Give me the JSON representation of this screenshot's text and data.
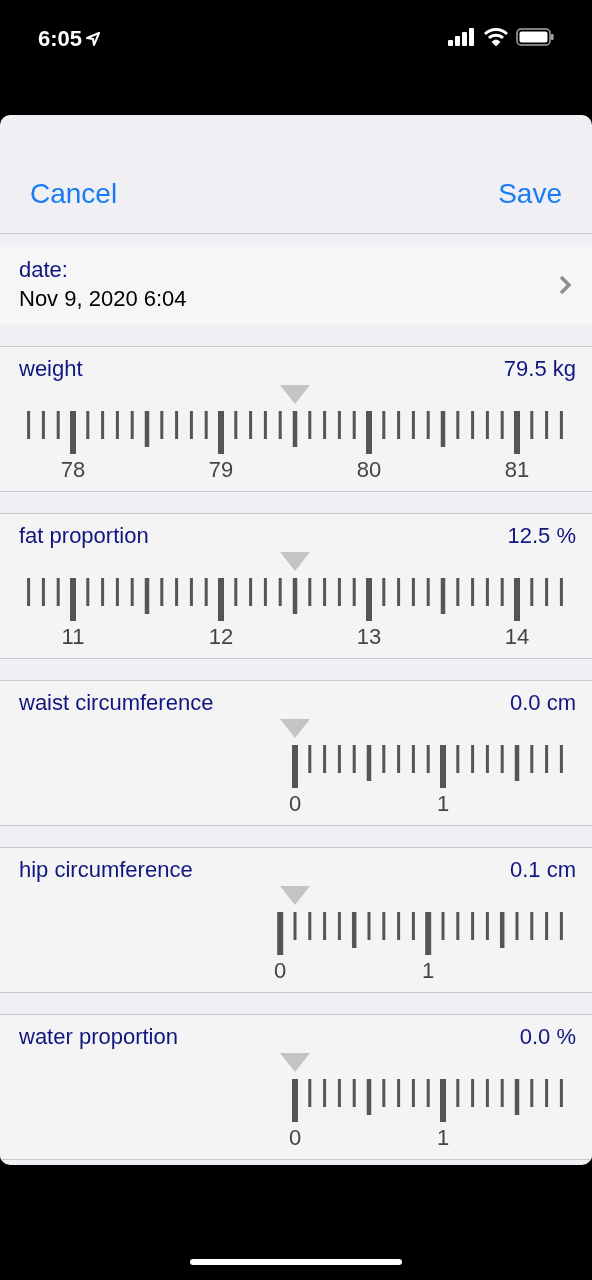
{
  "status_bar": {
    "time": "6:05"
  },
  "nav": {
    "cancel": "Cancel",
    "save": "Save"
  },
  "date_row": {
    "label": "date:",
    "value": "Nov 9, 2020 6:04"
  },
  "measurements": [
    {
      "name": "weight",
      "reading": "79.5 kg",
      "tick_labels": [
        "78",
        "79",
        "80",
        "81"
      ]
    },
    {
      "name": "fat proportion",
      "reading": "12.5 %",
      "tick_labels": [
        "11",
        "12",
        "13",
        "14"
      ]
    },
    {
      "name": "waist circumference",
      "reading": "0.0 cm",
      "tick_labels": [
        "0",
        "1"
      ]
    },
    {
      "name": "hip circumference",
      "reading": "0.1 cm",
      "tick_labels": [
        "0",
        "1"
      ]
    },
    {
      "name": "water proportion",
      "reading": "0.0 %",
      "tick_labels": [
        "0",
        "1"
      ]
    }
  ]
}
